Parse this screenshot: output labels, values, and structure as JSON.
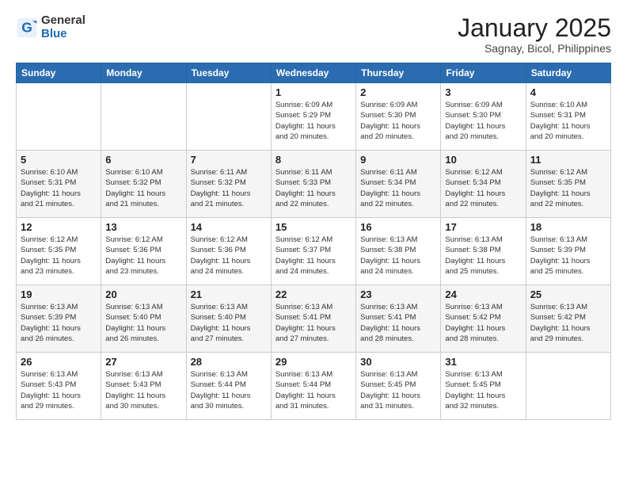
{
  "header": {
    "logo_general": "General",
    "logo_blue": "Blue",
    "month_title": "January 2025",
    "location": "Sagnay, Bicol, Philippines"
  },
  "days_of_week": [
    "Sunday",
    "Monday",
    "Tuesday",
    "Wednesday",
    "Thursday",
    "Friday",
    "Saturday"
  ],
  "weeks": [
    [
      {
        "day": "",
        "info": ""
      },
      {
        "day": "",
        "info": ""
      },
      {
        "day": "",
        "info": ""
      },
      {
        "day": "1",
        "info": "Sunrise: 6:09 AM\nSunset: 5:29 PM\nDaylight: 11 hours\nand 20 minutes."
      },
      {
        "day": "2",
        "info": "Sunrise: 6:09 AM\nSunset: 5:30 PM\nDaylight: 11 hours\nand 20 minutes."
      },
      {
        "day": "3",
        "info": "Sunrise: 6:09 AM\nSunset: 5:30 PM\nDaylight: 11 hours\nand 20 minutes."
      },
      {
        "day": "4",
        "info": "Sunrise: 6:10 AM\nSunset: 5:31 PM\nDaylight: 11 hours\nand 20 minutes."
      }
    ],
    [
      {
        "day": "5",
        "info": "Sunrise: 6:10 AM\nSunset: 5:31 PM\nDaylight: 11 hours\nand 21 minutes."
      },
      {
        "day": "6",
        "info": "Sunrise: 6:10 AM\nSunset: 5:32 PM\nDaylight: 11 hours\nand 21 minutes."
      },
      {
        "day": "7",
        "info": "Sunrise: 6:11 AM\nSunset: 5:32 PM\nDaylight: 11 hours\nand 21 minutes."
      },
      {
        "day": "8",
        "info": "Sunrise: 6:11 AM\nSunset: 5:33 PM\nDaylight: 11 hours\nand 22 minutes."
      },
      {
        "day": "9",
        "info": "Sunrise: 6:11 AM\nSunset: 5:34 PM\nDaylight: 11 hours\nand 22 minutes."
      },
      {
        "day": "10",
        "info": "Sunrise: 6:12 AM\nSunset: 5:34 PM\nDaylight: 11 hours\nand 22 minutes."
      },
      {
        "day": "11",
        "info": "Sunrise: 6:12 AM\nSunset: 5:35 PM\nDaylight: 11 hours\nand 22 minutes."
      }
    ],
    [
      {
        "day": "12",
        "info": "Sunrise: 6:12 AM\nSunset: 5:35 PM\nDaylight: 11 hours\nand 23 minutes."
      },
      {
        "day": "13",
        "info": "Sunrise: 6:12 AM\nSunset: 5:36 PM\nDaylight: 11 hours\nand 23 minutes."
      },
      {
        "day": "14",
        "info": "Sunrise: 6:12 AM\nSunset: 5:36 PM\nDaylight: 11 hours\nand 24 minutes."
      },
      {
        "day": "15",
        "info": "Sunrise: 6:12 AM\nSunset: 5:37 PM\nDaylight: 11 hours\nand 24 minutes."
      },
      {
        "day": "16",
        "info": "Sunrise: 6:13 AM\nSunset: 5:38 PM\nDaylight: 11 hours\nand 24 minutes."
      },
      {
        "day": "17",
        "info": "Sunrise: 6:13 AM\nSunset: 5:38 PM\nDaylight: 11 hours\nand 25 minutes."
      },
      {
        "day": "18",
        "info": "Sunrise: 6:13 AM\nSunset: 5:39 PM\nDaylight: 11 hours\nand 25 minutes."
      }
    ],
    [
      {
        "day": "19",
        "info": "Sunrise: 6:13 AM\nSunset: 5:39 PM\nDaylight: 11 hours\nand 26 minutes."
      },
      {
        "day": "20",
        "info": "Sunrise: 6:13 AM\nSunset: 5:40 PM\nDaylight: 11 hours\nand 26 minutes."
      },
      {
        "day": "21",
        "info": "Sunrise: 6:13 AM\nSunset: 5:40 PM\nDaylight: 11 hours\nand 27 minutes."
      },
      {
        "day": "22",
        "info": "Sunrise: 6:13 AM\nSunset: 5:41 PM\nDaylight: 11 hours\nand 27 minutes."
      },
      {
        "day": "23",
        "info": "Sunrise: 6:13 AM\nSunset: 5:41 PM\nDaylight: 11 hours\nand 28 minutes."
      },
      {
        "day": "24",
        "info": "Sunrise: 6:13 AM\nSunset: 5:42 PM\nDaylight: 11 hours\nand 28 minutes."
      },
      {
        "day": "25",
        "info": "Sunrise: 6:13 AM\nSunset: 5:42 PM\nDaylight: 11 hours\nand 29 minutes."
      }
    ],
    [
      {
        "day": "26",
        "info": "Sunrise: 6:13 AM\nSunset: 5:43 PM\nDaylight: 11 hours\nand 29 minutes."
      },
      {
        "day": "27",
        "info": "Sunrise: 6:13 AM\nSunset: 5:43 PM\nDaylight: 11 hours\nand 30 minutes."
      },
      {
        "day": "28",
        "info": "Sunrise: 6:13 AM\nSunset: 5:44 PM\nDaylight: 11 hours\nand 30 minutes."
      },
      {
        "day": "29",
        "info": "Sunrise: 6:13 AM\nSunset: 5:44 PM\nDaylight: 11 hours\nand 31 minutes."
      },
      {
        "day": "30",
        "info": "Sunrise: 6:13 AM\nSunset: 5:45 PM\nDaylight: 11 hours\nand 31 minutes."
      },
      {
        "day": "31",
        "info": "Sunrise: 6:13 AM\nSunset: 5:45 PM\nDaylight: 11 hours\nand 32 minutes."
      },
      {
        "day": "",
        "info": ""
      }
    ]
  ]
}
